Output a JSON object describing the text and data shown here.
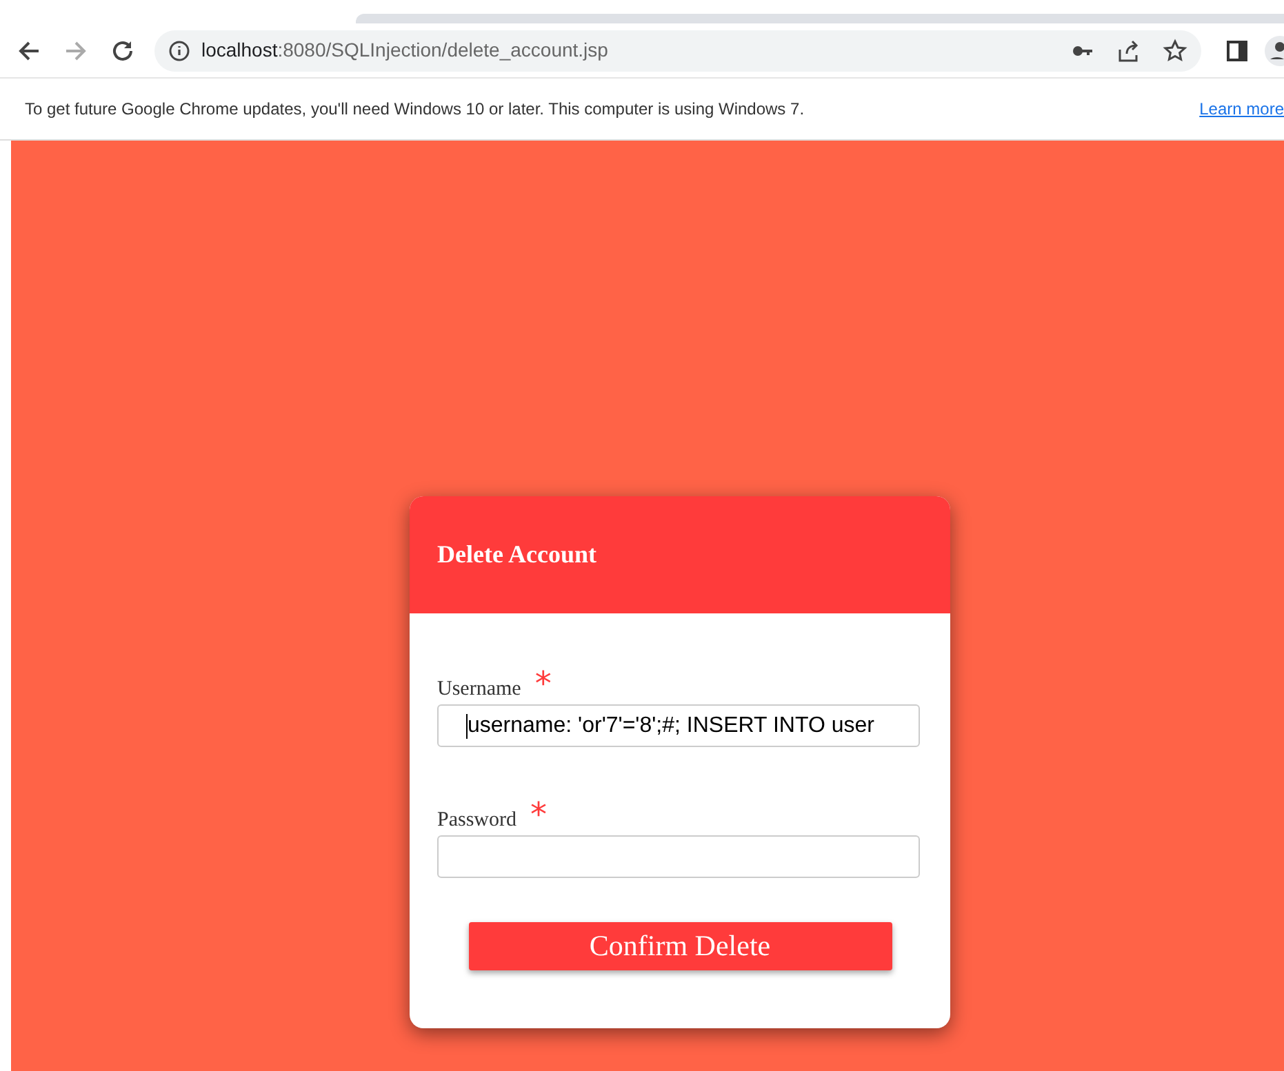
{
  "browser": {
    "url_host": "localhost",
    "url_rest": ":8080/SQLInjection/delete_account.jsp"
  },
  "infobar": {
    "message": "To get future Google Chrome updates, you'll need Windows 10 or later. This computer is using Windows 7.",
    "link": "Learn more"
  },
  "card": {
    "title": "Delete Account",
    "fields": [
      {
        "label": "Username",
        "required_mark": "*",
        "value": "username: 'or'7'='8';#; INSERT INTO user",
        "focused": true
      },
      {
        "label": "Password",
        "required_mark": "*",
        "focused": false
      }
    ],
    "button": "Confirm Delete"
  }
}
